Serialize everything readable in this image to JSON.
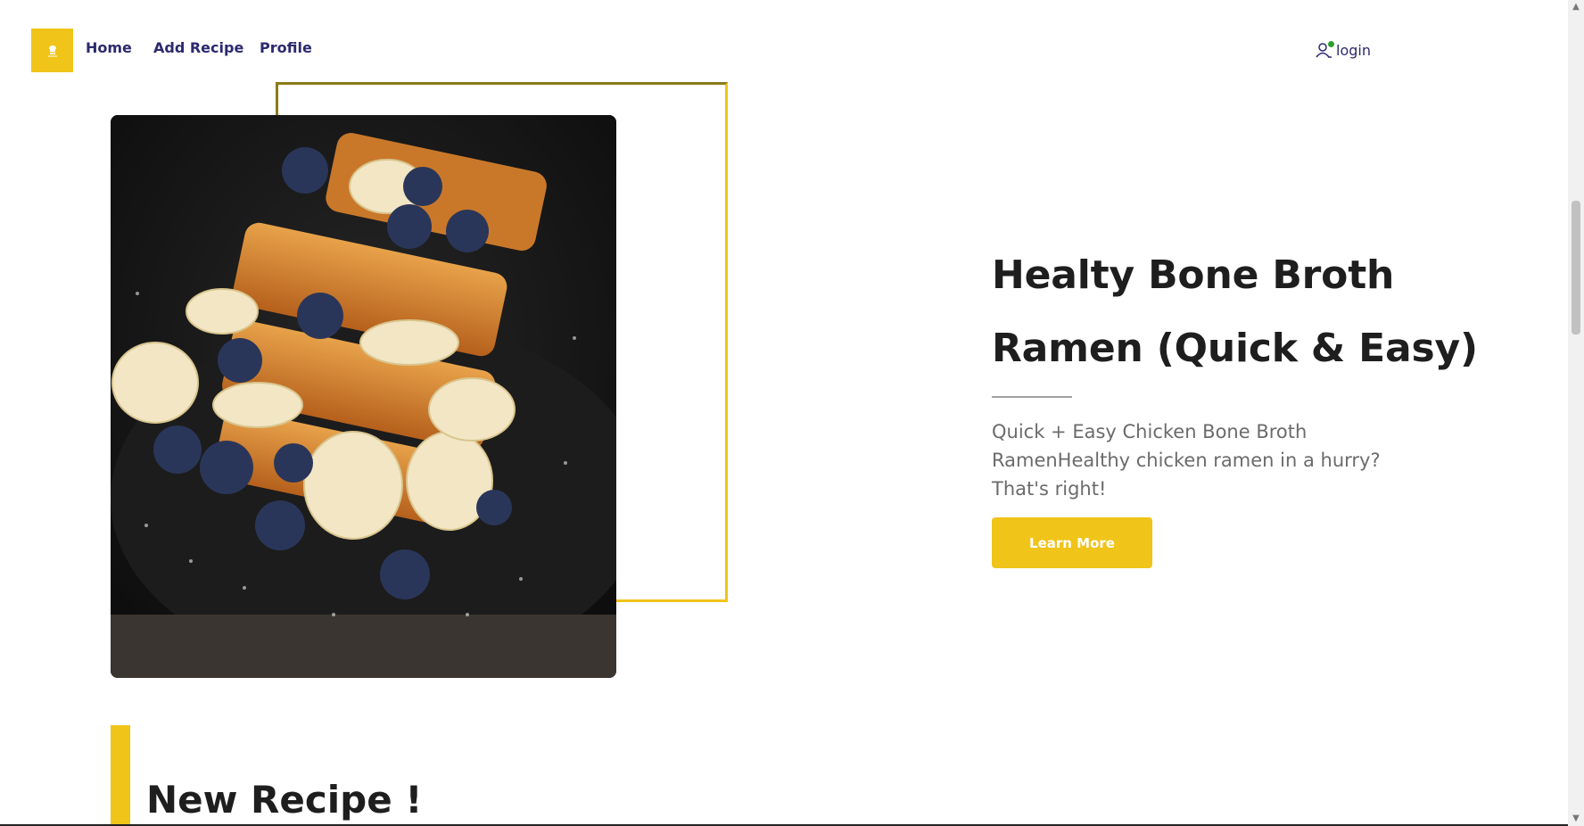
{
  "nav": {
    "logo_icon": "chef-icon",
    "links": [
      "Home",
      "Add Recipe",
      "Profile"
    ],
    "login_label": "login",
    "login_icon": "user-icon"
  },
  "hero": {
    "title_line1": "Healty Bone Broth",
    "title_line2": "Ramen (Quick & Easy)",
    "description": "Quick + Easy Chicken Bone Broth RamenHealthy chicken ramen in a hurry? That's right!",
    "button_label": "Learn More",
    "image_icon": "french-toast-photo"
  },
  "section": {
    "title": "New Recipe !"
  },
  "colors": {
    "accent": "#f0c419",
    "nav_text": "#2c2a6e",
    "title_text": "#1e1e1e",
    "desc_text": "#6b6b6b",
    "online_dot": "#2ca02c"
  }
}
